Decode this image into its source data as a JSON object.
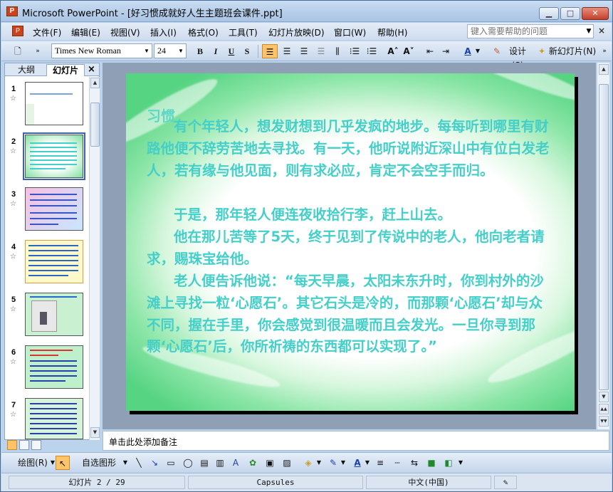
{
  "window": {
    "title": "Microsoft PowerPoint - [好习惯成就好人生主题班会课件.ppt]",
    "app_icon_glyph": "P",
    "min_glyph": "▁",
    "max_glyph": "□",
    "close_glyph": "✕"
  },
  "menubar": {
    "items": [
      "文件(F)",
      "编辑(E)",
      "视图(V)",
      "插入(I)",
      "格式(O)",
      "工具(T)",
      "幻灯片放映(D)",
      "窗口(W)",
      "帮助(H)"
    ],
    "help_placeholder": "键入需要帮助的问题",
    "close_glyph": "×"
  },
  "toolbar": {
    "font_name": "Times New Roman",
    "font_size": "24",
    "bold": "B",
    "italic": "I",
    "underline": "U",
    "shadow": "S",
    "design_label": "设计(S)",
    "new_slide_label": "新幻灯片(N)"
  },
  "leftpane": {
    "tab_outline": "大纲",
    "tab_slides": "幻灯片",
    "close_glyph": "×",
    "slides": [
      {
        "num": "1",
        "star": "☆"
      },
      {
        "num": "2",
        "star": "☆"
      },
      {
        "num": "3",
        "star": "☆"
      },
      {
        "num": "4",
        "star": "☆"
      },
      {
        "num": "5",
        "star": "☆"
      },
      {
        "num": "6",
        "star": "☆"
      },
      {
        "num": "7",
        "star": "☆"
      }
    ]
  },
  "slide": {
    "title": "习惯",
    "paragraphs": [
      "有个年轻人，想发财想到几乎发疯的地步。每每听到哪里有财路他便不辞劳苦地去寻找。有一天，他听说附近深山中有位白发老人，若有缘与他见面，则有求必应，肯定不会空手而归。",
      "于是，那年轻人便连夜收拾行李，赶上山去。",
      "他在那儿苦等了5天，终于见到了传说中的老人，他向老者请求，赐珠宝给他。",
      "老人便告诉他说：“每天早晨，太阳未东升时，你到村外的沙滩上寻找一粒‘心愿石’。其它石头是冷的，而那颗‘心愿石’却与众不同，握在手里，你会感觉到很温暖而且会发光。一旦你寻到那颗‘心愿石’后，你所祈祷的东西都可以实现了。”"
    ]
  },
  "notes": {
    "placeholder": "单击此处添加备注"
  },
  "drawbar": {
    "draw_label": "绘图(R)",
    "autoshape_label": "自选图形(U)"
  },
  "statusbar": {
    "slide_pos": "幻灯片 2 / 29",
    "design": "Capsules",
    "language": "中文(中国)"
  },
  "colors": {
    "slide_text": "#44cfc9",
    "slide_green": "#56d482",
    "ui_blue": "#bcd3ec"
  }
}
